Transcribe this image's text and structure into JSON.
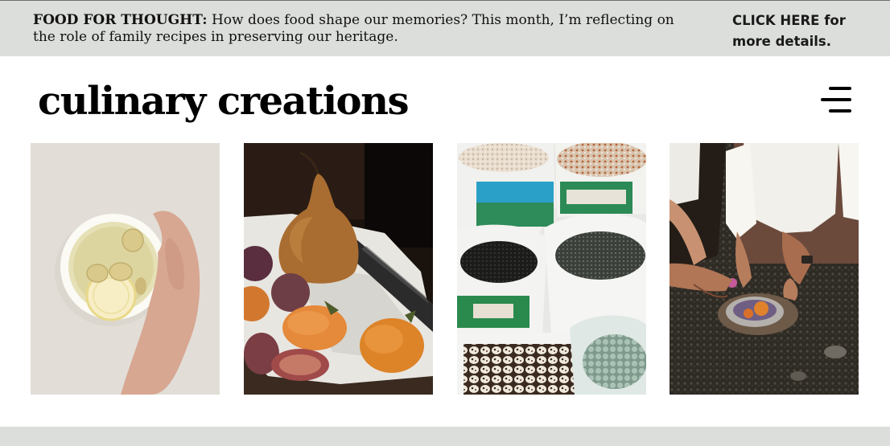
{
  "announcement": {
    "label": "FOOD FOR THOUGHT:",
    "message": "How does food shape our memories? This month, I’m reflecting on the role of family recipes in preserving our heritage.",
    "cta_line1": "CLICK HERE for",
    "cta_line2": "more details."
  },
  "header": {
    "brand": "culinary creations",
    "menu_icon": "hamburger-menu-icon"
  },
  "gallery": [
    {
      "name": "photo-lemon-ginger-bowl"
    },
    {
      "name": "photo-pear-figs-persimmons"
    },
    {
      "name": "photo-grain-sacks"
    },
    {
      "name": "photo-hands-bowl"
    }
  ],
  "colors": {
    "banner_bg": "#dcdedb",
    "text": "#111111",
    "page_bg": "#ffffff"
  }
}
